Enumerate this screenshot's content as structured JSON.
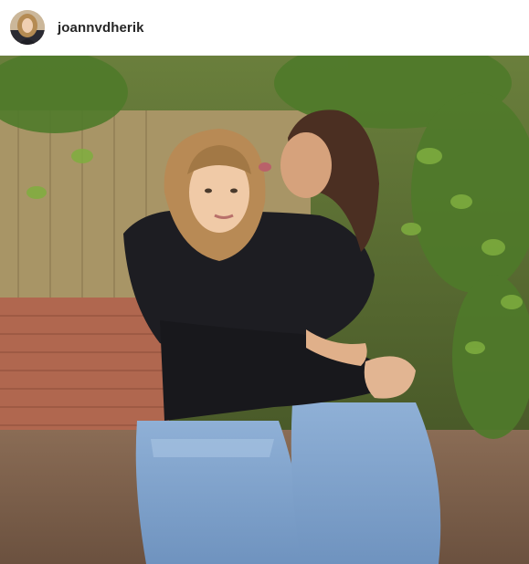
{
  "post": {
    "username": "joannvdherik",
    "avatar_icon": "profile-avatar",
    "image_alt": "Photo"
  },
  "colors": {
    "username_text": "#262626",
    "header_background": "#ffffff",
    "header_border": "#efefef"
  }
}
